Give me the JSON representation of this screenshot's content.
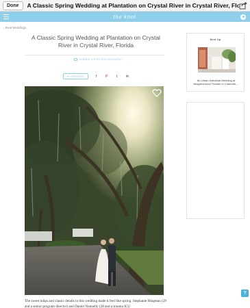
{
  "topbar": {
    "done_label": "Done",
    "title": "A Classic Spring Wedding at Plantation on Crystal River in Crystal River, Florida",
    "share_icon": "share-icon"
  },
  "header": {
    "logo": "the knot",
    "accent": "#8ed0ec",
    "menu_icon": "menu-icon",
    "user_icon": "user-icon"
  },
  "breadcrumb": "‹ Real Weddings",
  "article": {
    "title": "A Classic Spring Wedding at Plantation on Crystal River in Crystal River, Florida",
    "photographer": "ROBBIE LOPEZ PHOTOGRAPHY",
    "save_label": "♥ 0 WEDDING",
    "social": {
      "facebook": "f",
      "pinterest": "P",
      "twitter": "t",
      "email": "✉"
    },
    "caption": "The sweet tulips and classic details in this wedding made it feel like spring. Stephanie Hingman (29 and a senior program director) and Daniel Nunnelly (28 and a trauma ICU"
  },
  "sidebar": {
    "next_up_label": "Next Up",
    "next_up_text": "An Urban Industrial Wedding at Neighborhood Theatre in Charlotte,..."
  },
  "help_label": "?"
}
